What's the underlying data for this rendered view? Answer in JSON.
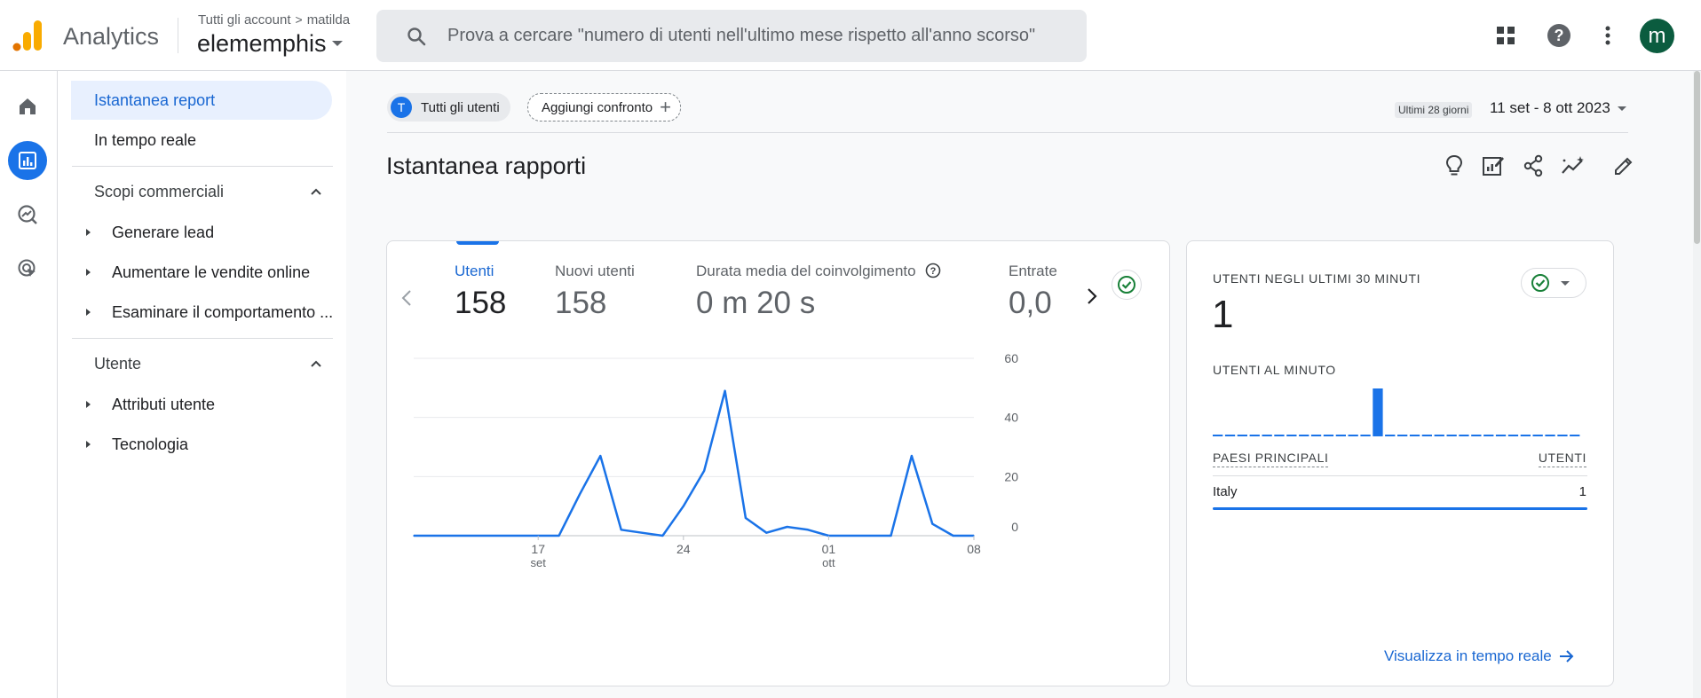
{
  "header": {
    "product_name": "Analytics",
    "breadcrumb": {
      "root": "Tutti gli account",
      "account": "matilda"
    },
    "property": "elememphis",
    "search_placeholder": "Prova a cercare \"numero di utenti nell'ultimo mese rispetto all'anno scorso\"",
    "icons": [
      "apps-grid-icon",
      "help-icon",
      "more-vert-icon"
    ],
    "avatar_initial": "m"
  },
  "rail": {
    "items": [
      "home-icon",
      "reports-icon",
      "explore-icon",
      "advertising-icon"
    ],
    "active": "reports-icon"
  },
  "subnav": {
    "items": [
      {
        "label": "Istantanea report",
        "active": true
      },
      {
        "label": "In tempo reale"
      }
    ],
    "sections": [
      {
        "label": "Scopi commerciali",
        "expanded": true,
        "children": [
          "Generare lead",
          "Aumentare le vendite online",
          "Esaminare il comportamento ..."
        ]
      },
      {
        "label": "Utente",
        "expanded": true,
        "children": [
          "Attributi utente",
          "Tecnologia"
        ]
      }
    ]
  },
  "toolbar": {
    "segment_chip": {
      "initial": "T",
      "label": "Tutti gli utenti"
    },
    "add_comparison": "Aggiungi confronto",
    "date_tag": "Ultimi 28 giorni",
    "date_range": "11 set - 8 ott 2023"
  },
  "page": {
    "title": "Istantanea rapporti",
    "tools": [
      "insights-icon",
      "customize-report-icon",
      "share-icon",
      "compare-trend-icon",
      "edit-icon"
    ]
  },
  "metrics": [
    {
      "label": "Utenti",
      "value": "158",
      "active": true
    },
    {
      "label": "Nuovi utenti",
      "value": "158"
    },
    {
      "label": "Durata media del coinvolgimento",
      "value": "0 m 20 s",
      "help": true
    },
    {
      "label": "Entrate",
      "value": "0,0"
    }
  ],
  "chart_data": {
    "type": "line",
    "x": [
      "11 set",
      "12 set",
      "13 set",
      "14 set",
      "15 set",
      "16 set",
      "17 set",
      "18 set",
      "19 set",
      "20 set",
      "21 set",
      "22 set",
      "23 set",
      "24 set",
      "25 set",
      "26 set",
      "27 set",
      "28 set",
      "29 set",
      "30 set",
      "01 ott",
      "02 ott",
      "03 ott",
      "04 ott",
      "05 ott",
      "06 ott",
      "07 ott",
      "08 ott"
    ],
    "series": [
      {
        "values": [
          0,
          0,
          0,
          0,
          0,
          0,
          0,
          0,
          14,
          27,
          2,
          1,
          0,
          10,
          22,
          49,
          6,
          1,
          3,
          2,
          0,
          0,
          0,
          0,
          27,
          4,
          0,
          0
        ],
        "color": "#1a73e8"
      }
    ],
    "ylim": [
      0,
      60
    ],
    "yticks": [
      "0",
      "20",
      "40",
      "60"
    ],
    "xticks": [
      {
        "label": "17",
        "sub": "set",
        "index": 6
      },
      {
        "label": "24",
        "sub": "",
        "index": 13
      },
      {
        "label": "01",
        "sub": "ott",
        "index": 20
      },
      {
        "label": "08",
        "sub": "",
        "index": 27
      }
    ],
    "grid": true,
    "y_axis_side": "right"
  },
  "realtime": {
    "title": "UTENTI NEGLI ULTIMI 30 MINUTI",
    "value": "1",
    "per_minute_label": "UTENTI AL MINUTO",
    "per_minute": [
      0,
      0,
      0,
      0,
      0,
      0,
      0,
      0,
      0,
      0,
      0,
      0,
      0,
      0,
      0,
      0,
      0,
      0,
      0,
      0,
      0,
      0,
      0,
      0,
      0,
      0,
      0,
      0,
      0,
      0
    ],
    "per_minute_peak_index": 13,
    "per_minute_peak_value": 1,
    "table_headers": {
      "left": "PAESI PRINCIPALI",
      "right": "UTENTI"
    },
    "rows": [
      {
        "country": "Italy",
        "users": "1"
      }
    ],
    "link": "Visualizza in tempo reale"
  },
  "colors": {
    "accent": "#1a73e8",
    "avatar": "#0b5c3f",
    "check": "#188038",
    "logo_orange": "#f9ab00",
    "logo_dark": "#e37400"
  }
}
